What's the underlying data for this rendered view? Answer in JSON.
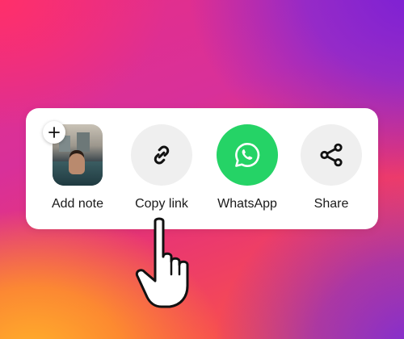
{
  "share_sheet": {
    "items": [
      {
        "label": "Add note",
        "icon": "plus-icon"
      },
      {
        "label": "Copy link",
        "icon": "link-icon"
      },
      {
        "label": "WhatsApp",
        "icon": "whatsapp-icon"
      },
      {
        "label": "Share",
        "icon": "share-icon"
      }
    ]
  },
  "colors": {
    "whatsapp_green": "#25d366",
    "icon_circle_gray": "#efefef",
    "sheet_background": "#ffffff"
  },
  "cursor": {
    "icon": "pointing-hand-icon",
    "target": "Copy link"
  }
}
